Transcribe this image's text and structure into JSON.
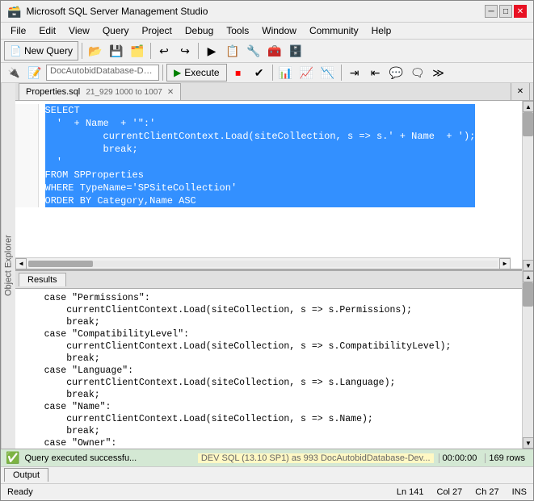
{
  "window": {
    "title": "Microsoft SQL Server Management Studio",
    "icon": "sql-server-icon"
  },
  "title_bar": {
    "title": "Microsoft SQL Server Management Studio",
    "min_label": "─",
    "max_label": "□",
    "close_label": "✕"
  },
  "menu": {
    "items": [
      "File",
      "Edit",
      "View",
      "Query",
      "Project",
      "Debug",
      "Tools",
      "Window",
      "Community",
      "Help"
    ]
  },
  "toolbar": {
    "new_query_label": "New Query",
    "execute_label": "Execute",
    "db_value": "DocAutobidDatabase-Dev ▼"
  },
  "tab": {
    "label": "Properties.sql",
    "meta": "21_929 1000 to 1007"
  },
  "editor": {
    "lines": [
      {
        "num": "",
        "code": "SELECT",
        "selected": true,
        "type": "keyword_line"
      },
      {
        "num": "",
        "code": "  '  ' + Name  + '\":'",
        "selected": true,
        "type": "string_line"
      },
      {
        "num": "",
        "code": "          currentClientContext.Load(siteCollection, s => s.' + Name  + ');",
        "selected": true
      },
      {
        "num": "",
        "code": "          break;",
        "selected": true
      },
      {
        "num": "",
        "code": "  '",
        "selected": true
      },
      {
        "num": "",
        "code": "FROM SPProperties",
        "selected": true,
        "type": "keyword_line"
      },
      {
        "num": "",
        "code": "WHERE TypeName='SPSiteCollection'",
        "selected": true,
        "type": "keyword_line"
      },
      {
        "num": "",
        "code": "ORDER BY Category,Name ASC",
        "selected": true,
        "type": "keyword_line"
      }
    ]
  },
  "results": {
    "tab_label": "Results",
    "lines": [
      "    case \"Permissions\":",
      "        currentClientContext.Load(siteCollection, s => s.Permissions);",
      "        break;",
      "    case \"CompatibilityLevel\":",
      "        currentClientContext.Load(siteCollection, s => s.CompatibilityLevel);",
      "        break;",
      "    case \"Language\":",
      "        currentClientContext.Load(siteCollection, s => s.Language);",
      "        break;",
      "    case \"Name\":",
      "        currentClientContext.Load(siteCollection, s => s.Name);",
      "        break;",
      "    case \"Owner\":"
    ]
  },
  "status": {
    "success_text": "Query executed successfu...",
    "server_info": "DEV SQL (13.10 SP1)  as 993   DocAutobidDatabase-Dev...",
    "time": "00:00:00",
    "rows": "169 rows"
  },
  "output_tab": {
    "label": "Output"
  },
  "info_bar": {
    "ready": "Ready",
    "ln": "Ln 141",
    "col": "Col 27",
    "ch": "Ch 27",
    "ins": "INS"
  },
  "sidebar": {
    "label": "Object Explorer"
  }
}
